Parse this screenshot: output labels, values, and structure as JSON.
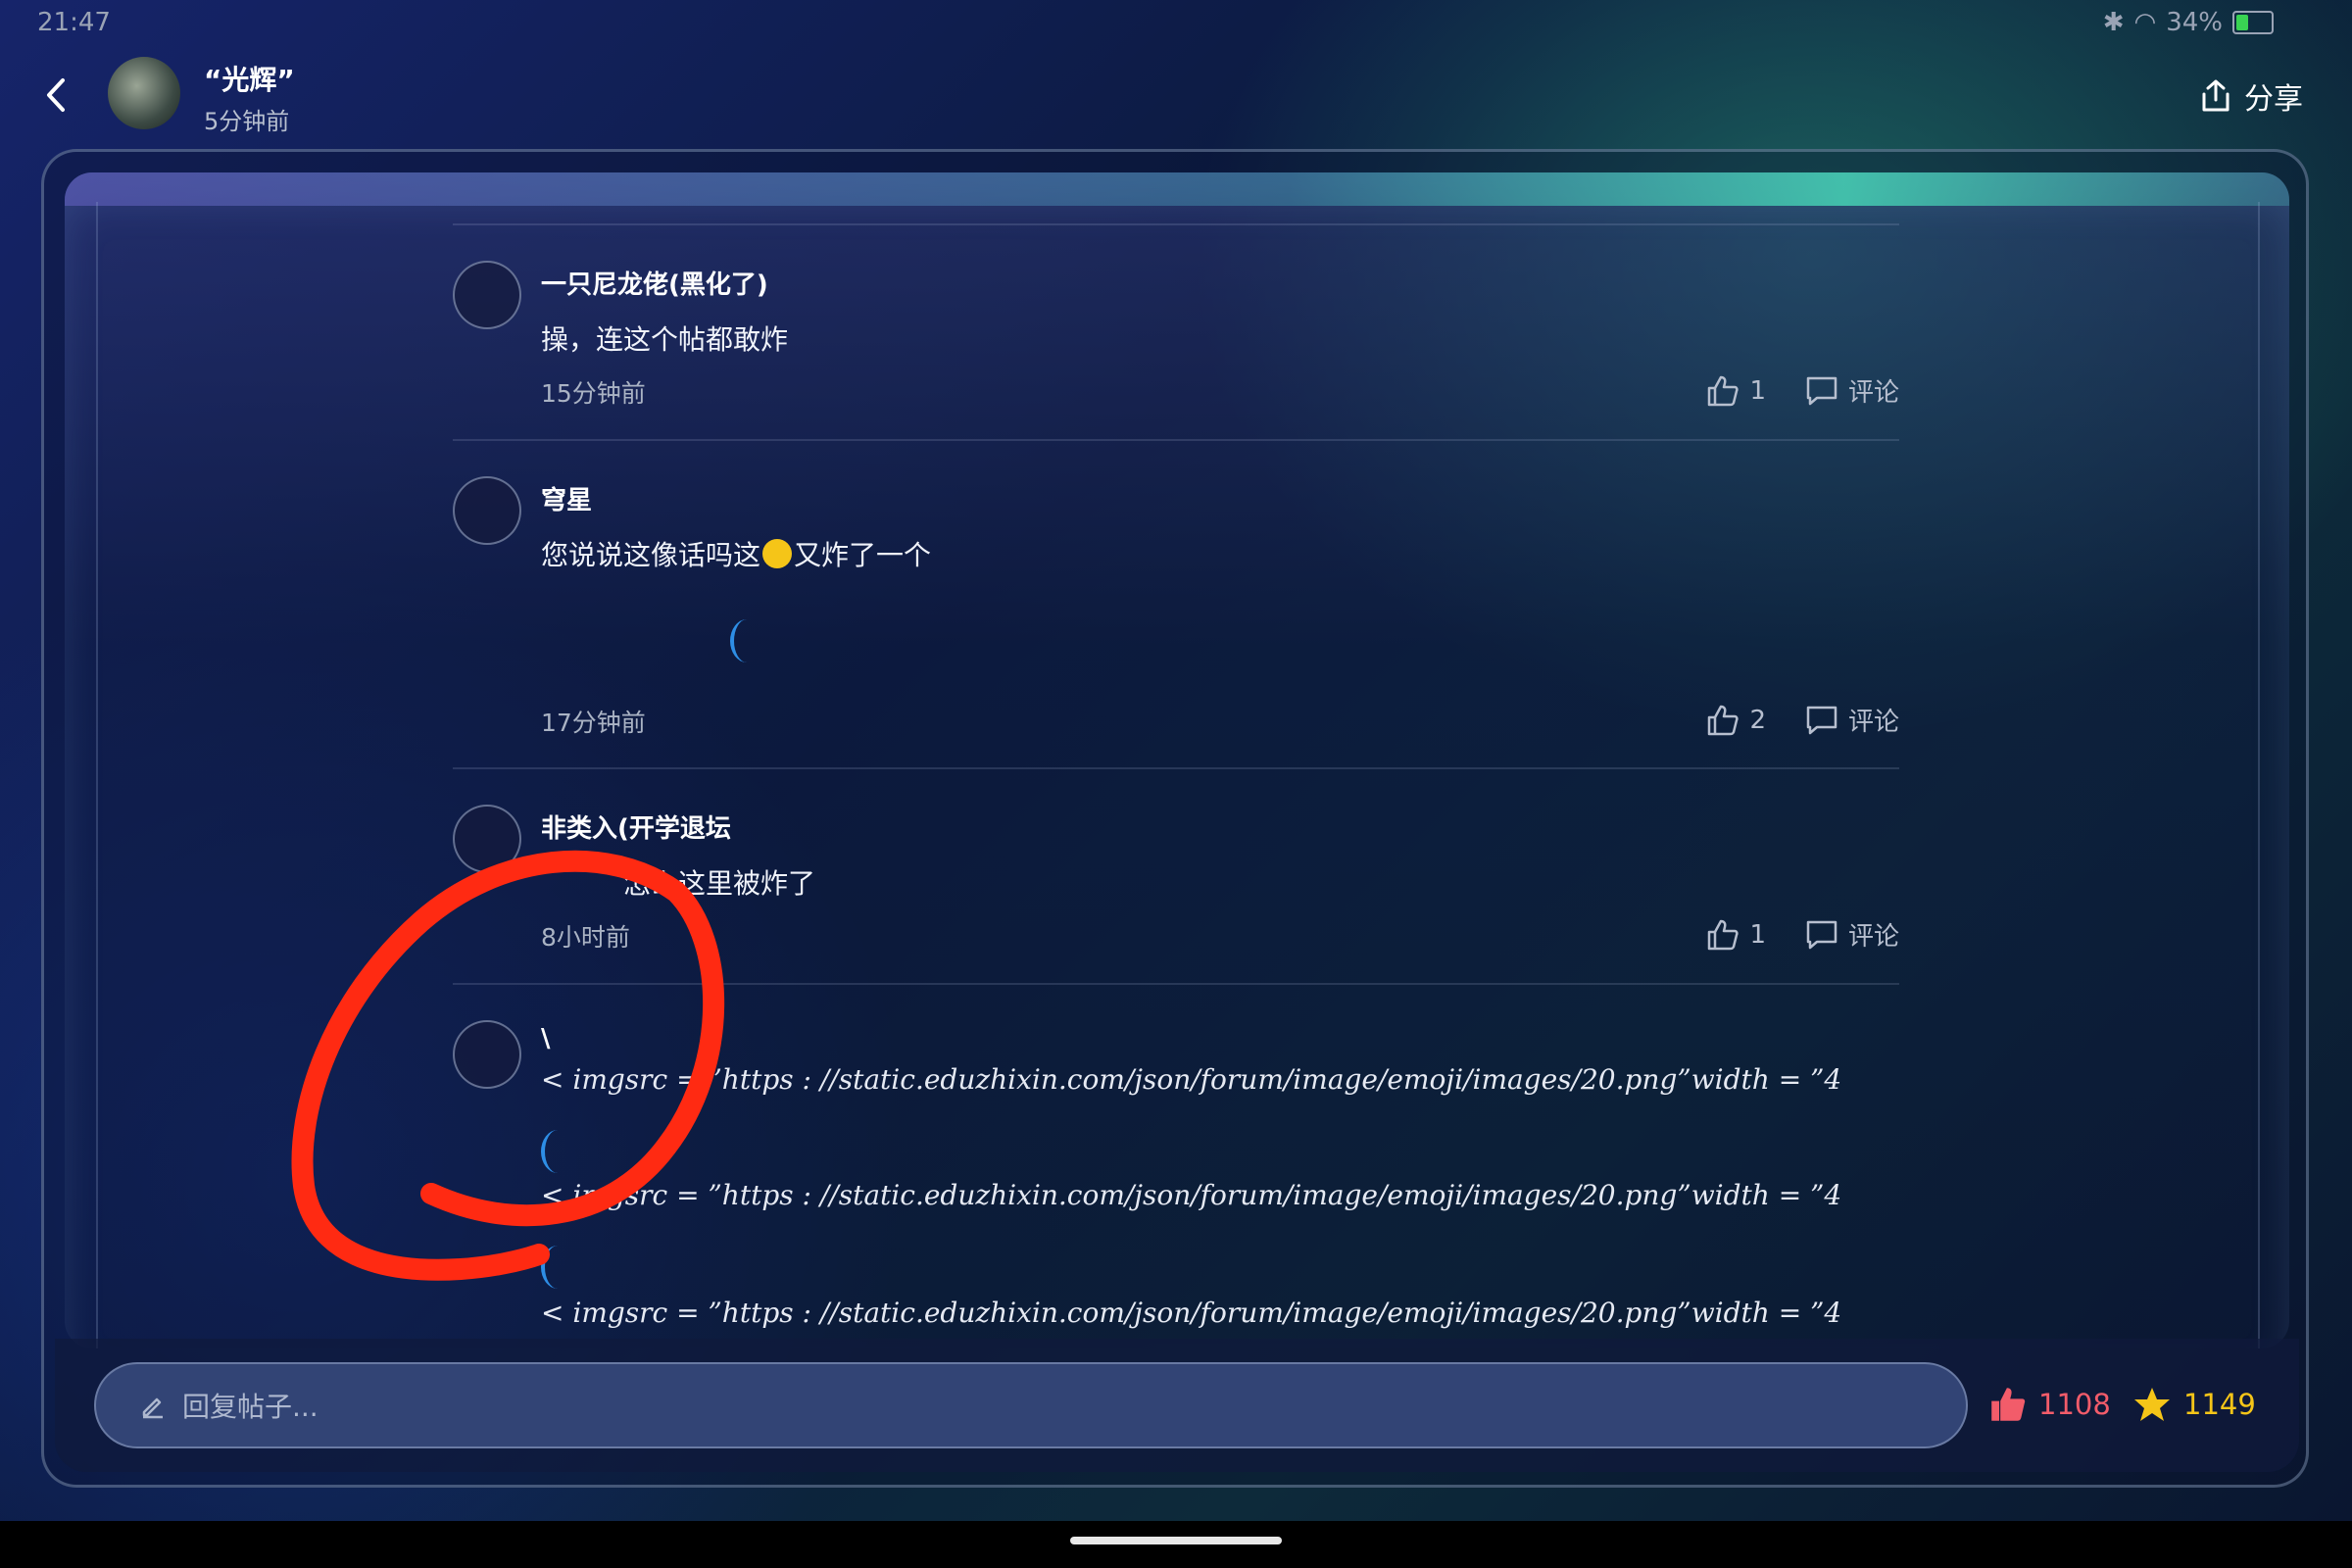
{
  "status_bar": {
    "time": "21:47",
    "battery": "34%",
    "battery_level": 0.34
  },
  "header": {
    "user_name": "“光辉”",
    "post_time": "5分钟前",
    "share_label": "分享"
  },
  "comments": [
    {
      "name": "一只尼龙佬(黑化了)",
      "text": "操，连这个帖都敢炸",
      "time": "15分钟前",
      "likes": "1",
      "comment_label": "评论"
    },
    {
      "name": "穹星",
      "text_before": "您说说这像话吗这",
      "emoji": "thinking-face",
      "text_after": "又炸了一个",
      "time": "17分钟前",
      "likes": "2",
      "comment_label": "评论"
    },
    {
      "name": "非类入(开学退坛",
      "text": "怎么这里被炸了",
      "time": "8小时前",
      "likes": "1",
      "comment_label": "评论"
    },
    {
      "name": "\\",
      "lines": [
        "< imgsrc = ”https : //static.eduzhixin.com/json/forum/image/emoji/images/20.png”width = ”4",
        "< imgsrc = ”https : //static.eduzhixin.com/json/forum/image/emoji/images/20.png”width = ”4",
        "< imgsrc = ”https : //static.eduzhixin.com/json/forum/image/emoji/images/20.png”width = ”4"
      ]
    }
  ],
  "reply": {
    "placeholder": "回复帖子..."
  },
  "stats": {
    "likes": "1108",
    "stars": "1149"
  },
  "colors": {
    "like": "#f25c6a",
    "star": "#f5c518",
    "spinner": "#2e8ee6",
    "annotation": "#ff2a12"
  }
}
